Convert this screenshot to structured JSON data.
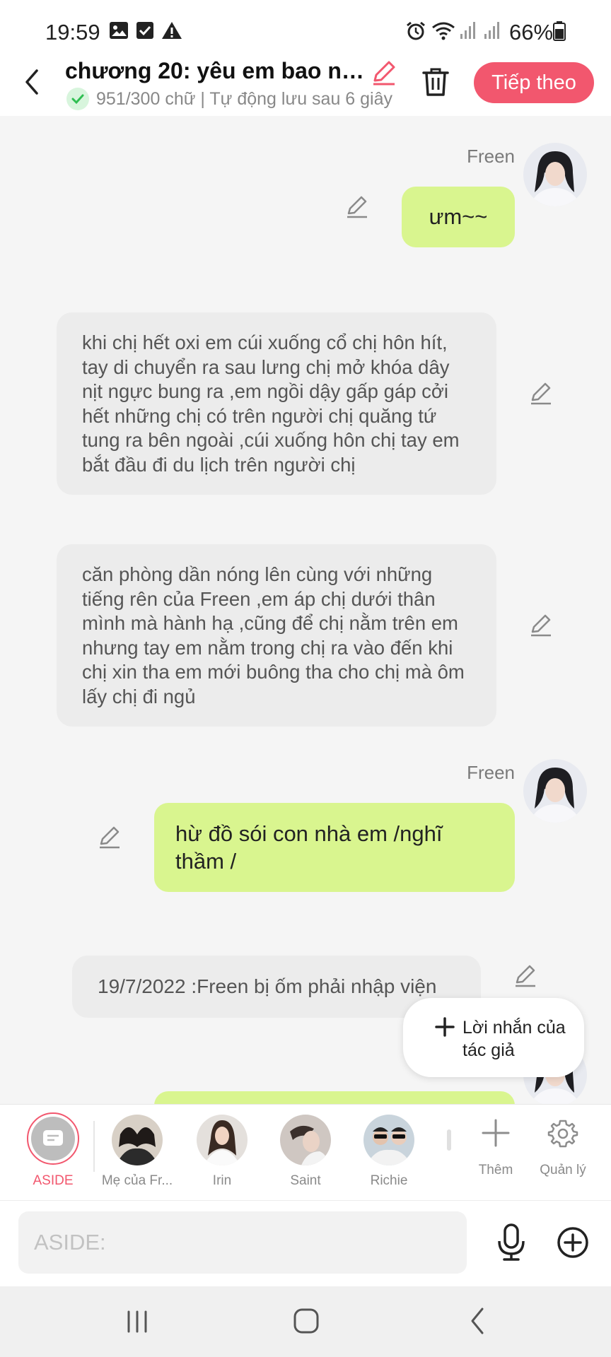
{
  "status_bar": {
    "time": "19:59",
    "battery": "66%",
    "icons": [
      "image-icon",
      "check-square-icon",
      "warning-icon",
      "alarm-icon",
      "wifi-icon",
      "signal-icon",
      "signal-icon",
      "battery-icon"
    ]
  },
  "header": {
    "title": "chương 20: yêu em bao nh...",
    "status": "951/300 chữ | Tự động lưu sau 6 giây",
    "next_label": "Tiếp theo",
    "accent": "#f2576e"
  },
  "messages": [
    {
      "type": "character",
      "name": "Freen",
      "text": "ưm~~"
    },
    {
      "type": "narration",
      "text": "khi chị hết oxi em cúi xuống cổ chị hôn hít, tay di chuyển ra sau lưng chị mở khóa dây nịt ngực bung ra ,em ngồi dậy gấp gáp cởi hết những chị có trên người chị quăng tứ tung ra bên ngoài ,cúi xuống hôn chị tay em bắt đầu đi du lịch trên người chị"
    },
    {
      "type": "narration",
      "text": "căn phòng dần nóng lên cùng với những tiếng rên của Freen ,em áp chị dưới thân mình mà hành hạ ,cũng để chị nằm trên em nhưng tay em nằm trong chị ra vào đến khi chị xin tha em mới buông tha cho chị mà ôm lấy chị đi ngủ"
    },
    {
      "type": "character",
      "name": "Freen",
      "text": "hừ đồ sói con nhà em /nghĩ thầm /"
    },
    {
      "type": "aside",
      "text": "19/7/2022 :Freen bị ốm phải nhập viện"
    }
  ],
  "author_note_popup": {
    "label": "Lời nhắn của tác giả"
  },
  "character_tray": {
    "items": [
      {
        "label": "ASIDE",
        "active": true
      },
      {
        "label": "Mẹ của Fr..."
      },
      {
        "label": "Irin"
      },
      {
        "label": "Saint"
      },
      {
        "label": "Richie"
      }
    ],
    "add_label": "Thêm",
    "manage_label": "Quản lý"
  },
  "input": {
    "placeholder": "ASIDE:"
  },
  "colors": {
    "bubble_green": "#d9f58f",
    "bubble_gray": "#ececec",
    "accent": "#f2576e"
  }
}
